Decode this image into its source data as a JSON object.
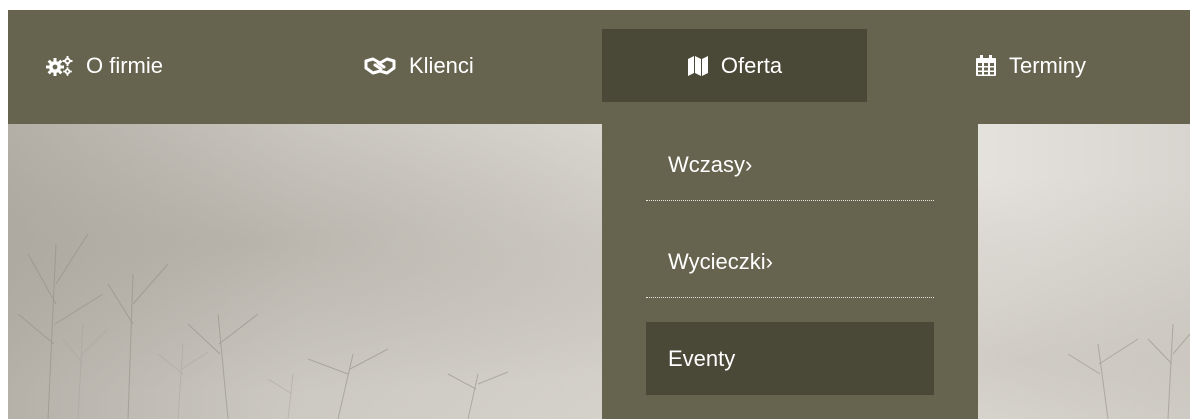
{
  "nav": {
    "items": [
      {
        "label": "O firmie",
        "icon": "cogs-icon"
      },
      {
        "label": "Klienci",
        "icon": "handshake-icon"
      },
      {
        "label": "Oferta",
        "icon": "map-icon"
      },
      {
        "label": "Terminy",
        "icon": "calendar-icon"
      }
    ],
    "active": "Oferta"
  },
  "dropdown": {
    "items": [
      {
        "label": "Wczasy›"
      },
      {
        "label": "Wycieczki›"
      },
      {
        "label": "Eventy"
      }
    ],
    "active": "Eventy"
  },
  "colors": {
    "nav_bg": "#66634e",
    "active_bg": "#4a4837",
    "text": "#ffffff"
  }
}
